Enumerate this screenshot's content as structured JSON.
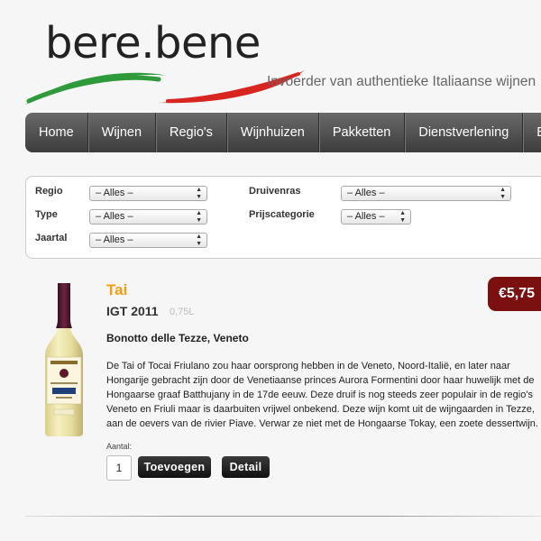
{
  "header": {
    "logo_text": "bere.bene",
    "tagline": "Invoerder van authentieke Italiaanse wijnen"
  },
  "nav": {
    "items": [
      "Home",
      "Wijnen",
      "Regio's",
      "Wijnhuizen",
      "Pakketten",
      "Dienstverlening",
      "Bib"
    ]
  },
  "filters": {
    "regio": {
      "label": "Regio",
      "value": "– Alles –"
    },
    "type": {
      "label": "Type",
      "value": "– Alles –"
    },
    "jaartal": {
      "label": "Jaartal",
      "value": "– Alles –"
    },
    "druivenras": {
      "label": "Druivenras",
      "value": "– Alles –"
    },
    "prijscategorie": {
      "label": "Prijscategorie",
      "value": "– Alles –"
    }
  },
  "product": {
    "name": "Tai",
    "vintage": "IGT 2011",
    "volume": "0,75L",
    "producer": "Bonotto delle Tezze, Veneto",
    "description": [
      "De Tai of Tocai Friulano zou haar oorsprong hebben in de Veneto, Noord-Italië, en later naar",
      "Hongarije gebracht zijn door de Venetiaanse  princes Aurora Formentini door haar huwelijk met de",
      "Hongaarse graaf Batthujany in de 17de eeuw. Deze druif is nog steeds zeer populair in de regio's",
      "Veneto en Friuli maar is daarbuiten vrijwel onbekend. Deze wijn komt uit de wijngaarden in Tezze,",
      "aan de oevers van de rivier Piave. Verwar ze niet met de Hongaarse Tokay, een zoete dessertwijn."
    ],
    "price": "€5,75",
    "quantity_label": "Aantal:",
    "quantity": "1",
    "add_button": "Toevoegen",
    "detail_button": "Detail"
  },
  "colors": {
    "accent_orange": "#f39c12",
    "price_bg": "#7a1010",
    "logo_green": "#2e9a3a",
    "logo_red": "#d8251f"
  }
}
